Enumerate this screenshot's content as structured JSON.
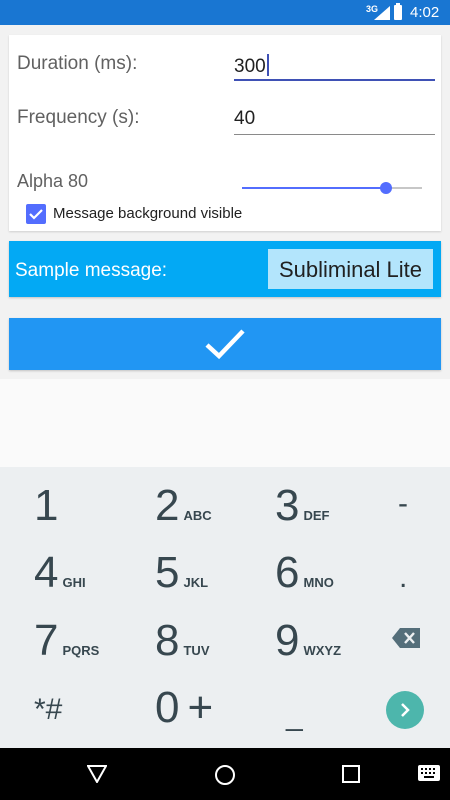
{
  "status_bar": {
    "network": "3G",
    "time": "4:02"
  },
  "settings": {
    "duration": {
      "label": "Duration (ms):",
      "value": "300"
    },
    "frequency": {
      "label": "Frequency (s):",
      "value": "40"
    },
    "alpha": {
      "label": "Alpha 80",
      "level": 0.8
    },
    "background_visible": {
      "label": "Message background visible",
      "checked": true
    }
  },
  "sample": {
    "label": "Sample message:",
    "value": "Subliminal Lite"
  },
  "confirm": {
    "icon": "check-icon"
  },
  "keypad": {
    "keys": [
      {
        "num": "1",
        "sub": ""
      },
      {
        "num": "2",
        "sub": "ABC"
      },
      {
        "num": "3",
        "sub": "DEF"
      },
      {
        "num": "-",
        "sub": ""
      },
      {
        "num": "4",
        "sub": "GHI"
      },
      {
        "num": "5",
        "sub": "JKL"
      },
      {
        "num": "6",
        "sub": "MNO"
      },
      {
        "num": ".",
        "sub": ""
      },
      {
        "num": "7",
        "sub": "PQRS"
      },
      {
        "num": "8",
        "sub": "TUV"
      },
      {
        "num": "9",
        "sub": "WXYZ"
      },
      {
        "num": "*#",
        "sub": ""
      },
      {
        "num": "0",
        "sub": "+"
      },
      {
        "num": "_",
        "sub": ""
      }
    ]
  },
  "colors": {
    "status": "#1976d2",
    "accent": "#536dfe",
    "sample_bar": "#03a9f4",
    "confirm": "#2196f3",
    "enter": "#4db6ac"
  }
}
